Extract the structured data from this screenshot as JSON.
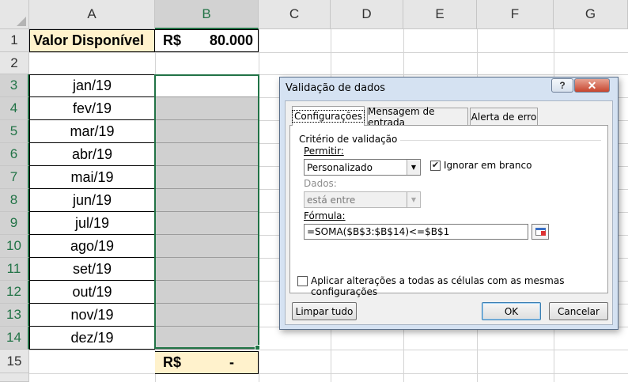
{
  "sheet": {
    "columns": [
      "A",
      "B",
      "C",
      "D",
      "E",
      "F",
      "G"
    ],
    "rows": [
      "1",
      "2",
      "3",
      "4",
      "5",
      "6",
      "7",
      "8",
      "9",
      "10",
      "11",
      "12",
      "13",
      "14",
      "15"
    ],
    "a1_label": "Valor Disponível",
    "b1_currency": "R$",
    "b1_value": "80.000",
    "months": [
      "jan/19",
      "fev/19",
      "mar/19",
      "abr/19",
      "mai/19",
      "jun/19",
      "jul/19",
      "ago/19",
      "set/19",
      "out/19",
      "nov/19",
      "dez/19"
    ],
    "b15_currency": "R$",
    "b15_value": "-",
    "colors": {
      "header_selected": "#217346",
      "input_fill": "#fff2cc",
      "range_fill": "#d0d0d0"
    }
  },
  "dialog": {
    "title": "Validação de dados",
    "help_icon": "?",
    "close_icon": "✕",
    "tabs": [
      {
        "label": "Configurações",
        "active": true
      },
      {
        "label": "Mensagem de entrada",
        "active": false
      },
      {
        "label": "Alerta de erro",
        "active": false
      }
    ],
    "criteria_group": "Critério de validação",
    "allow_label": "Permitir:",
    "allow_value": "Personalizado",
    "ignore_blank_label": "Ignorar em branco",
    "ignore_blank_checked": true,
    "data_label": "Dados:",
    "data_value": "está entre",
    "formula_label": "Fórmula:",
    "formula_value": "=SOMA($B$3:$B$14)<=$B$1",
    "apply_all_label": "Aplicar alterações a todas as células com as mesmas configurações",
    "apply_all_checked": false,
    "clear_button": "Limpar tudo",
    "ok_button": "OK",
    "cancel_button": "Cancelar"
  }
}
